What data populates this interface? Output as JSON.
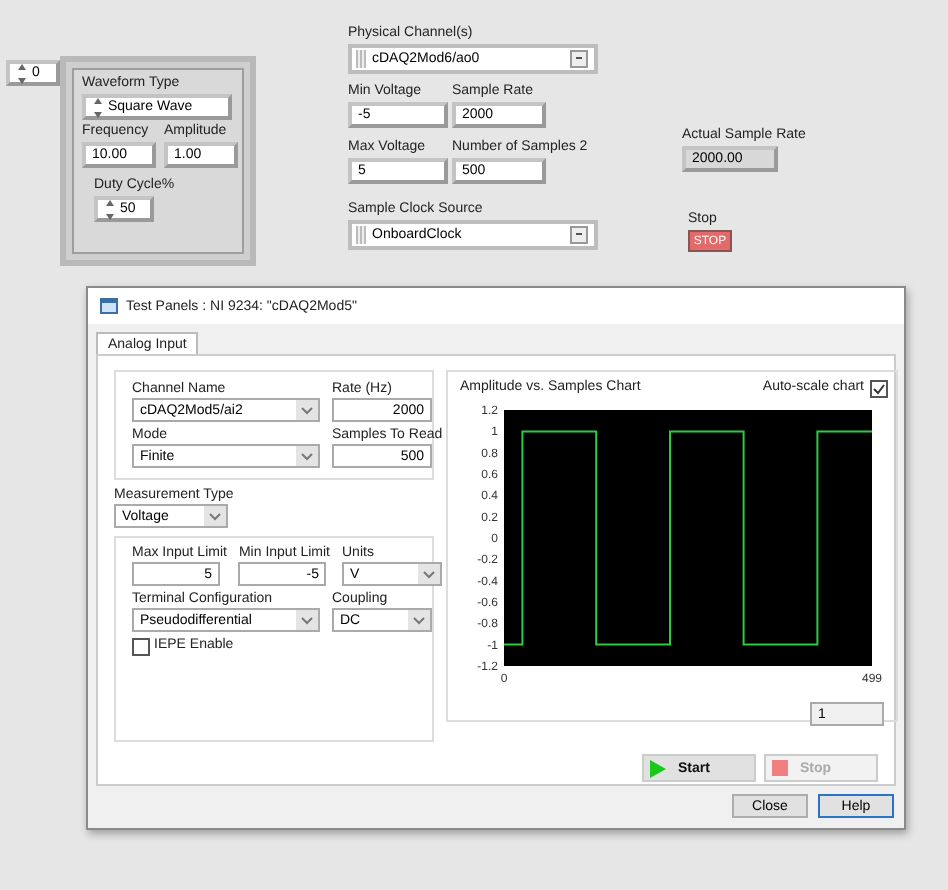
{
  "front_panel": {
    "index": {
      "value": "0"
    },
    "waveform_cluster": {
      "waveform_type": {
        "label": "Waveform Type",
        "value": "Square Wave"
      },
      "frequency": {
        "label": "Frequency",
        "value": "10.00"
      },
      "amplitude": {
        "label": "Amplitude",
        "value": "1.00"
      },
      "duty_cycle": {
        "label": "Duty Cycle%",
        "value": "50"
      }
    },
    "controls": [
      {
        "kind": "combo",
        "label": "Physical Channel(s)",
        "value": "cDAQ2Mod6/ao0"
      },
      {
        "kind": "numeric",
        "label": "Min Voltage",
        "value": "-5"
      },
      {
        "kind": "numeric",
        "label": "Sample Rate",
        "value": "2000"
      },
      {
        "kind": "numeric",
        "label": "Max Voltage",
        "value": "5"
      },
      {
        "kind": "numeric",
        "label": "Number of Samples 2",
        "value": "500"
      },
      {
        "kind": "combo",
        "label": "Sample Clock Source",
        "value": "OnboardClock"
      },
      {
        "kind": "indicator",
        "label": "Actual Sample Rate",
        "value": "2000.00"
      },
      {
        "kind": "button",
        "label": "Stop",
        "value": "STOP"
      }
    ]
  },
  "dialog": {
    "title": "Test Panels : NI 9234: \"cDAQ2Mod5\"",
    "tabs": [
      {
        "label": "Analog Input",
        "selected": true
      }
    ],
    "channel_name": {
      "label": "Channel Name",
      "value": "cDAQ2Mod5/ai2"
    },
    "rate": {
      "label": "Rate (Hz)",
      "value": "2000"
    },
    "mode": {
      "label": "Mode",
      "value": "Finite"
    },
    "samples_to_read": {
      "label": "Samples To Read",
      "value": "500"
    },
    "measurement_type": {
      "label": "Measurement Type",
      "value": "Voltage"
    },
    "max_input_limit": {
      "label": "Max Input Limit",
      "value": "5"
    },
    "min_input_limit": {
      "label": "Min Input Limit",
      "value": "-5"
    },
    "units": {
      "label": "Units",
      "value": "V"
    },
    "terminal_configuration": {
      "label": "Terminal Configuration",
      "value": "Pseudodifferential"
    },
    "coupling": {
      "label": "Coupling",
      "value": "DC"
    },
    "iepe_enable": {
      "label": "IEPE Enable",
      "checked": false
    },
    "chart": {
      "title": "Amplitude vs. Samples Chart",
      "auto_scale": {
        "label": "Auto-scale chart",
        "checked": true
      },
      "chart_data": {
        "type": "line",
        "x": [
          0,
          25,
          25,
          125,
          125,
          225,
          225,
          325,
          325,
          425,
          425,
          499
        ],
        "series": [
          {
            "color": "#2ecc40",
            "values": [
              -1,
              -1,
              1,
              1,
              -1,
              -1,
              1,
              1,
              -1,
              -1,
              1,
              1
            ]
          }
        ],
        "xlim": [
          0,
          499
        ],
        "ylim": [
          -1.2,
          1.2
        ],
        "xticks": [
          0,
          499
        ],
        "yticks": [
          -1.2,
          -1,
          -0.8,
          -0.6,
          -0.4,
          -0.2,
          0,
          0.2,
          0.4,
          0.6,
          0.8,
          1,
          1.2
        ]
      },
      "history": "1"
    },
    "start": {
      "label": "Start",
      "disabled": false
    },
    "stop": {
      "label": "Stop",
      "disabled": true
    },
    "buttons": [
      "Close",
      "Help"
    ]
  }
}
